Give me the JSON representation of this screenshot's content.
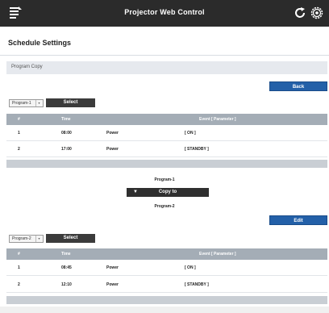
{
  "header": {
    "title": "Projector Web Control",
    "menu_icon": "menu-icon",
    "refresh_icon": "refresh-icon",
    "settings_icon": "gear-icon"
  },
  "page": {
    "title": "Schedule Settings",
    "section": "Program Copy"
  },
  "source": {
    "back_label": "Back",
    "program_select": "Program-1",
    "select_label": "Select",
    "columns": [
      "#",
      "Time",
      "Event [ Parameter ]"
    ],
    "rows": [
      {
        "num": "1",
        "time": "08:00",
        "event": "Power",
        "param": "[ ON ]"
      },
      {
        "num": "2",
        "time": "17:00",
        "event": "Power",
        "param": "[ STANDBY ]"
      }
    ]
  },
  "copy": {
    "from": "Program-1",
    "label": "Copy to",
    "to": "Program-2"
  },
  "target": {
    "edit_label": "Edit",
    "program_select": "Program-2",
    "select_label": "Select",
    "columns": [
      "#",
      "Time",
      "Event [ Parameter ]"
    ],
    "rows": [
      {
        "num": "1",
        "time": "08:45",
        "event": "Power",
        "param": "[ ON ]"
      },
      {
        "num": "2",
        "time": "12:10",
        "event": "Power",
        "param": "[ STANDBY ]"
      }
    ]
  },
  "colors": {
    "topbar": "#2b2b2b",
    "accent_blue": "#2360a8",
    "table_header": "#a4adb6"
  }
}
